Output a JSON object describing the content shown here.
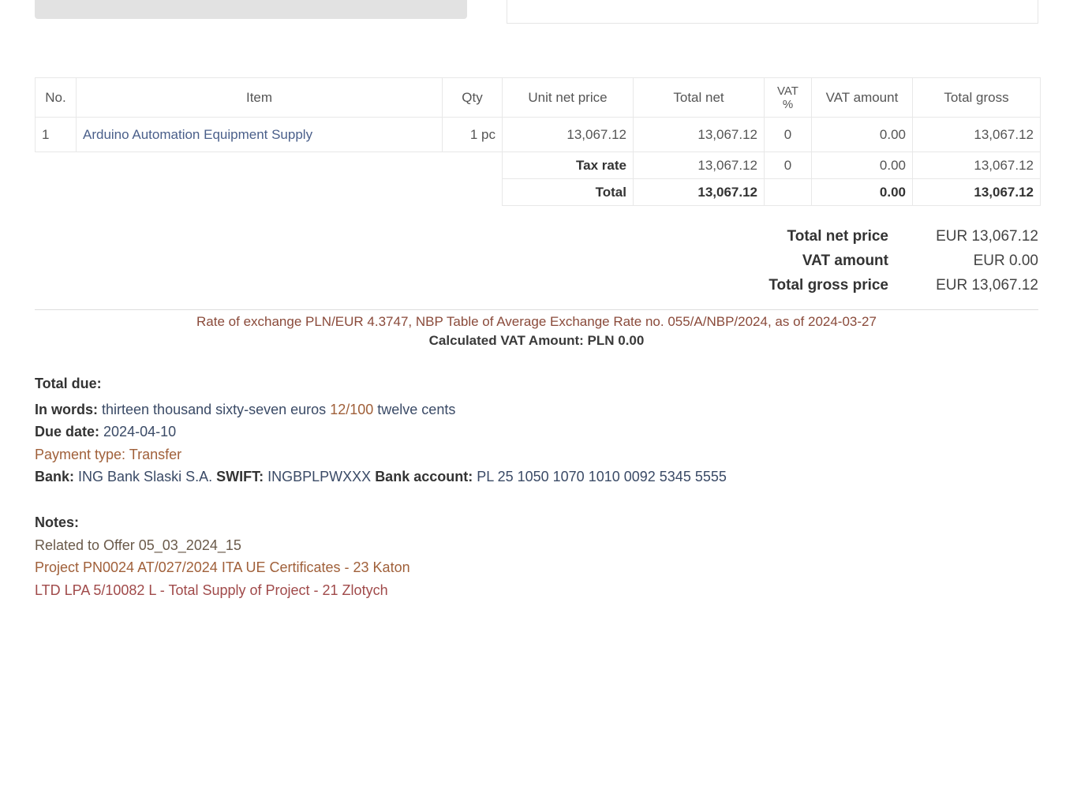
{
  "table": {
    "headers": {
      "no": "No.",
      "item": "Item",
      "qty": "Qty",
      "unit_net": "Unit net price",
      "total_net": "Total net",
      "vat_pct": "VAT %",
      "vat_amount": "VAT amount",
      "total_gross": "Total gross"
    },
    "row": {
      "no": "1",
      "item": "Arduino Automation Equipment Supply",
      "qty": "1 pc",
      "unit_net": "13,067.12",
      "total_net": "13,067.12",
      "vat_pct": "0",
      "vat_amount": "0.00",
      "total_gross": "13,067.12"
    },
    "tax_rate": {
      "label": "Tax rate",
      "total_net": "13,067.12",
      "vat_pct": "0",
      "vat_amount": "0.00",
      "total_gross": "13,067.12"
    },
    "total": {
      "label": "Total",
      "total_net": "13,067.12",
      "vat_amount": "0.00",
      "total_gross": "13,067.12"
    }
  },
  "summary": {
    "net_label": "Total net price",
    "net_value": "EUR 13,067.12",
    "vat_label": "VAT amount",
    "vat_value": "EUR 0.00",
    "gross_label": "Total gross price",
    "gross_value": "EUR 13,067.12"
  },
  "exchange": {
    "line1": "Rate of exchange PLN/EUR 4.3747, NBP Table of Average Exchange Rate no. 055/A/NBP/2024, as of 2024-03-27",
    "line2": "Calculated VAT Amount: PLN 0.00"
  },
  "details": {
    "heading": "Total due:",
    "in_words_label": "In words:",
    "in_words_value": "thirteen thousand sixty-seven euros",
    "in_words_cents": "12/100",
    "in_words_suffix": "twelve cents",
    "due_date_label": "Due date:",
    "due_date_value": "2024-04-10",
    "payment_type_label": "Payment type:",
    "payment_type_value": "Transfer",
    "bank_label": "Bank:",
    "bank_value": "ING Bank Slaski S.A.",
    "swift_label": "SWIFT:",
    "swift_value": "INGBPLPWXXX",
    "account_label": "Bank account:",
    "account_value": "PL 25 1050 1070 1010 0092 5345 5555"
  },
  "notes": {
    "heading": "Notes:",
    "line1": "Related to Offer 05_03_2024_15",
    "line2": "Project PN0024 AT/027/2024 ITA UE Certificates - 23 Katon",
    "line3": "LTD LPA 5/10082 L - Total Supply of Project - 21 Zlotych"
  }
}
